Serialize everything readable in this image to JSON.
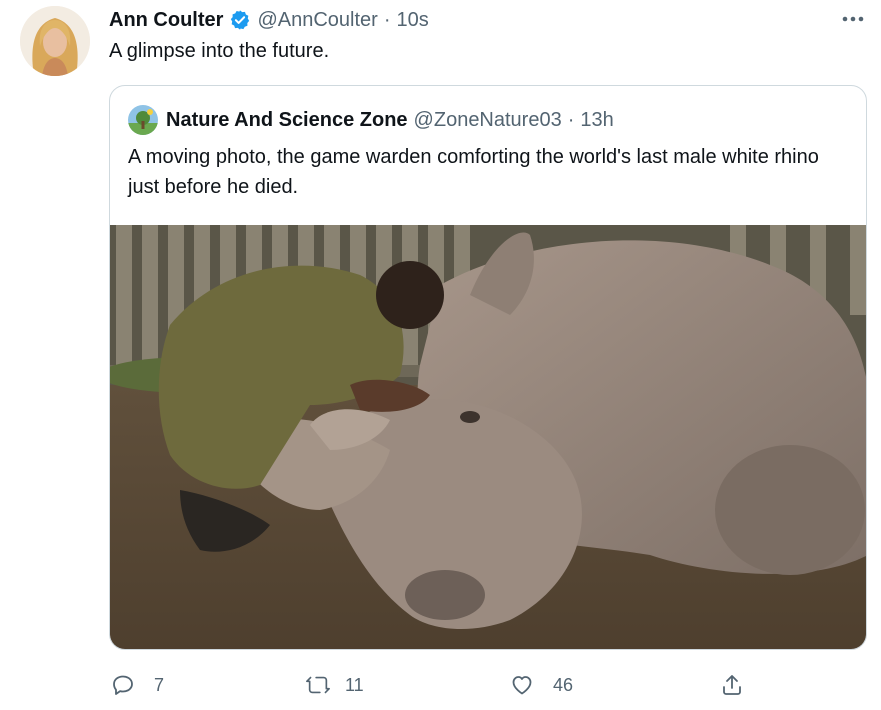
{
  "tweet": {
    "author_name": "Ann Coulter",
    "author_handle": "@AnnCoulter",
    "separator": "·",
    "time": "10s",
    "text": "A glimpse into the future.",
    "verified": true
  },
  "quoted_tweet": {
    "author_name": "Nature And Science Zone",
    "author_handle": "@ZoneNature03",
    "separator": "·",
    "time": "13h",
    "text": "A moving photo, the game warden comforting the world's last male white rhino just before he died."
  },
  "actions": {
    "reply_count": "7",
    "retweet_count": "11",
    "like_count": "46"
  },
  "icons": {
    "more": "more-horizontal-icon",
    "verified": "verified-badge-icon",
    "reply": "reply-icon",
    "retweet": "retweet-icon",
    "like": "heart-icon",
    "share": "share-icon"
  },
  "colors": {
    "text": "#0f1419",
    "secondary": "#536471",
    "verified_blue": "#1d9bf0",
    "border": "#cfd9de"
  }
}
